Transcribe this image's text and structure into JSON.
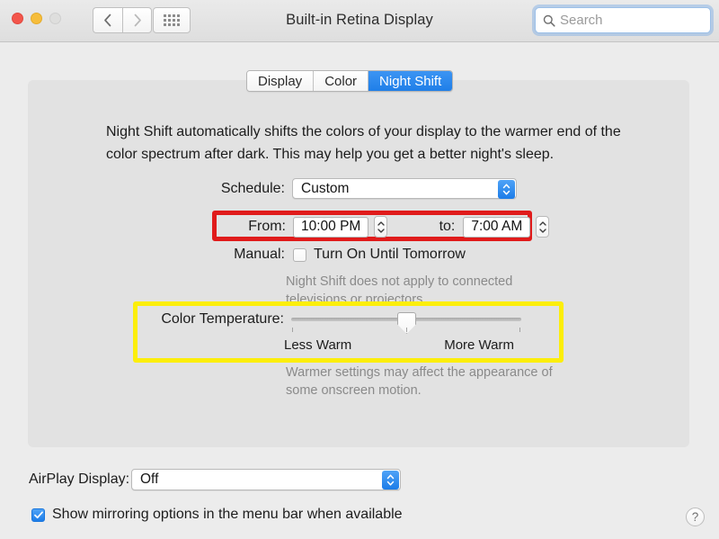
{
  "window": {
    "title": "Built-in Retina Display",
    "traffic_lights": [
      "close",
      "minimize",
      "zoom"
    ],
    "nav_back": "back-chevron",
    "nav_forward": "forward-chevron",
    "grid_button": "show-all-grid"
  },
  "search": {
    "placeholder": "Search",
    "value": "",
    "icon": "search-icon"
  },
  "tabs": [
    {
      "label": "Display",
      "active": false
    },
    {
      "label": "Color",
      "active": false
    },
    {
      "label": "Night Shift",
      "active": true
    }
  ],
  "description": "Night Shift automatically shifts the colors of your display to the warmer end of the color spectrum after dark. This may help you get a better night's sleep.",
  "schedule": {
    "label": "Schedule:",
    "value": "Custom"
  },
  "time_range": {
    "from_label": "From:",
    "from_value": "10:00 PM",
    "to_label": "to:",
    "to_value": "7:00 AM"
  },
  "manual": {
    "label": "Manual:",
    "checkbox_label": "Turn On Until Tomorrow",
    "checked": false,
    "hint": "Night Shift does not apply to connected televisions or projectors."
  },
  "color_temperature": {
    "label": "Color Temperature:",
    "less_warm": "Less Warm",
    "more_warm": "More Warm",
    "value_percent": 50,
    "hint": "Warmer settings may affect the appearance of some onscreen motion."
  },
  "airplay": {
    "label": "AirPlay Display:",
    "value": "Off"
  },
  "mirroring": {
    "checkbox_label": "Show mirroring options in the menu bar when available",
    "checked": true
  },
  "help": {
    "glyph": "?"
  },
  "highlights": {
    "red_box_color": "#e01b1b",
    "yellow_box_color": "#fcee0a",
    "accent_blue": "#1c7ce8"
  }
}
